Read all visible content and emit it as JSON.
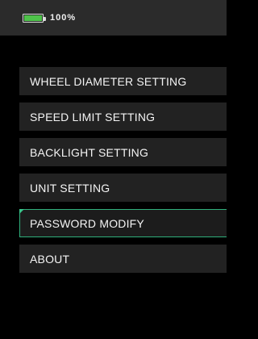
{
  "status": {
    "battery_percent_text": "100%",
    "battery_level": 1.0,
    "battery_color": "#4ec24a"
  },
  "menu": {
    "items": [
      {
        "label": "WHEEL DIAMETER SETTING"
      },
      {
        "label": "SPEED LIMIT SETTING"
      },
      {
        "label": "BACKLIGHT SETTING"
      },
      {
        "label": "UNIT SETTING"
      },
      {
        "label": "PASSWORD MODIFY",
        "selected": true
      },
      {
        "label": "ABOUT"
      }
    ],
    "selected_index": 4,
    "accent_color": "#2fb07c"
  }
}
